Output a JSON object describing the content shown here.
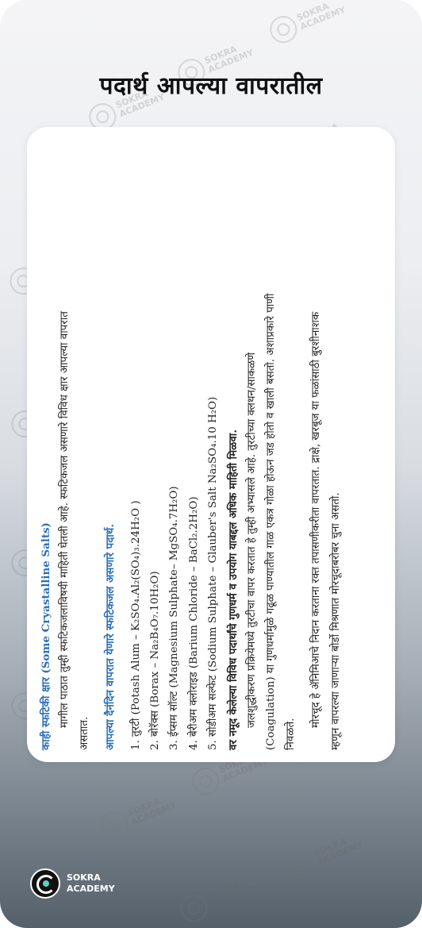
{
  "title": "पदार्थ आपल्या वापरातील",
  "content": {
    "heading": "काही स्फटिकी क्षार (Some Cryastalline Salts)",
    "intro_line1": "मागील पाठात तुम्ही स्फटिकजलाविषयी माहिती घेतली आहे. स्फटिकजल असणारे विविध क्षार आपल्या वापरात",
    "intro_line2": "असतात.",
    "subheading": "आपल्या दैनंदिन वापरात येणारे स्फटिकजल असणारे पदार्थ.",
    "items": [
      "1. तुरटी (Potash Alum – K₂SO₄.Al₂(SO₄)₃.24H₂O )",
      "2. बोरॅक्स (Borax – Na₂B₄O₇.10H₂O)",
      "3. ईप्सम सॉल्ट (Magnesium Sulphate– MgSO₄.7H₂O)",
      "4. बेरीअम क्लोराइड (Barium Chloride – BaCl₂.2H₂O)",
      "5. सोडीअम सल्फेट (Sodium Sulphate – Glauber's Salt  Na₂SO₄.10 H₂O)"
    ],
    "task": "वर नमूद केलेल्या विविध पदार्थांचे गुणधर्म व उपयोग याबद्दल अधिक माहिती मिळवा.",
    "para1_line1": "जलशुद्धीकरण प्रक्रियेमध्ये तुरटीचा वापर करतात हे तुम्ही अभ्यासले आहे. तुरटीच्या क्लथन/साकळणे",
    "para1_line2": "(Coagulation) या गुणधर्मामुळे गढूळ पाण्यातील गाळ एकत्र गोळा होऊन जड होतो व खाली बसतो. अशाप्रकारे पाणी",
    "para1_line3": "निवळते.",
    "para2_line1": "मोरचूद हे ॲनिमिआचे निदान करताना रक्त तपासणीकरीता वापरतात. द्राक्षे, खरबूज या फळांसाठी बुरशीनाशक",
    "para2_line2": "म्हणून वापरल्या जाणाऱ्या बोर्डो मिश्रणात मोरचूदाबरोबर चुना असतो."
  },
  "watermark": {
    "line1": "SOKRA",
    "line2": "ACADEMY"
  },
  "logo": {
    "line1": "SOKRA",
    "line2": "ACADEMY"
  }
}
